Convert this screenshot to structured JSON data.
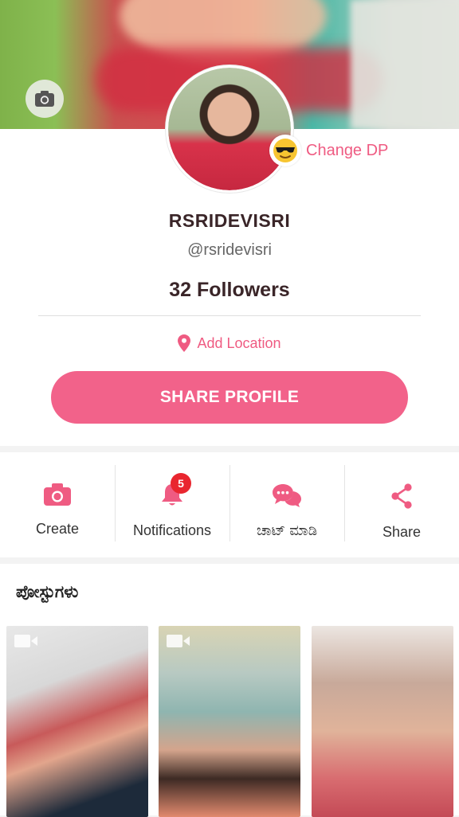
{
  "profile": {
    "change_dp_label": "Change DP",
    "username": "RSRIDEVISRI",
    "handle": "@rsridevisri",
    "followers": "32 Followers",
    "location_label": "Add Location",
    "share_profile_label": "SHARE PROFILE"
  },
  "actions": [
    {
      "label": "Create",
      "icon": "camera-icon"
    },
    {
      "label": "Notifications",
      "icon": "bell-icon",
      "badge": "5"
    },
    {
      "label": "ಚಾಟ್ ಮಾಡಿ",
      "icon": "chat-icon"
    },
    {
      "label": "Share",
      "icon": "share-icon"
    }
  ],
  "posts": {
    "title": "ಪೋಸ್ಟುಗಳು",
    "items": [
      {
        "type": "video"
      },
      {
        "type": "video"
      },
      {
        "type": "image"
      }
    ]
  },
  "colors": {
    "accent": "#f2628a",
    "accent_text": "#ef5b82",
    "badge": "#e9262f"
  }
}
